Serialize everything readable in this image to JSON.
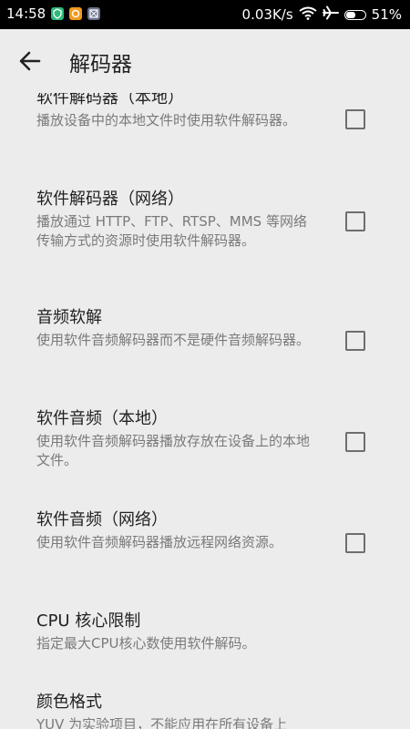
{
  "status_bar": {
    "time": "14:58",
    "network_speed": "0.03K/s",
    "battery_percent": "51%",
    "battery_level": 0.51
  },
  "app_bar": {
    "title": "解码器"
  },
  "colors": {
    "background": "#ececec",
    "status_bar": "#000000",
    "title_text": "#222222",
    "summary_text": "#7a7a7a",
    "checkbox_border": "#6e6e6e"
  },
  "preferences": [
    {
      "title": "软件解码器（本地）",
      "summary": "播放设备中的本地文件时使用软件解码器。",
      "has_checkbox": true,
      "checked": false
    },
    {
      "title": "软件解码器（网络）",
      "summary": "播放通过 HTTP、FTP、RTSP、MMS 等网络传输方式的资源时使用软件解码器。",
      "has_checkbox": true,
      "checked": false
    },
    {
      "title": "音频软解",
      "summary": "使用软件音频解码器而不是硬件音频解码器。",
      "has_checkbox": true,
      "checked": false
    },
    {
      "title": "软件音频（本地）",
      "summary": "使用软件音频解码器播放存放在设备上的本地文件。",
      "has_checkbox": true,
      "checked": false
    },
    {
      "title": "软件音频（网络）",
      "summary": "使用软件音频解码器播放远程网络资源。",
      "has_checkbox": true,
      "checked": false
    },
    {
      "title": "CPU 核心限制",
      "summary": "指定最大CPU核心数使用软件解码。",
      "has_checkbox": false
    },
    {
      "title": "颜色格式",
      "summary": "YUV 为实验项目，不能应用在所有设备上",
      "has_checkbox": false
    }
  ]
}
